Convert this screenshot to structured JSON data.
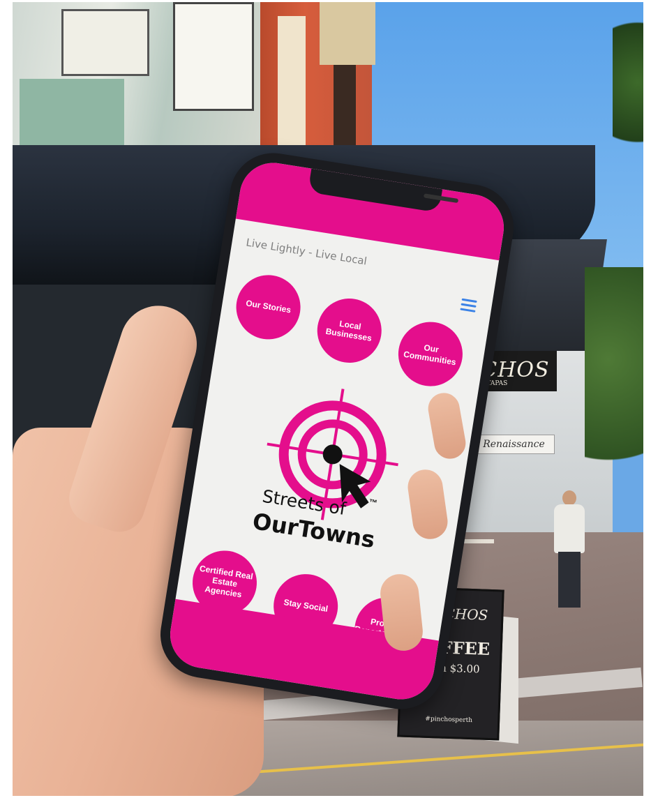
{
  "app": {
    "tagline": "Live Lightly - Live Local",
    "brand_line1": "Streets of",
    "brand_line2": "OurTowns",
    "trademark": "™",
    "accent_color": "#e40e8c",
    "menu_icon": "hamburger-menu-icon"
  },
  "nav_top": [
    {
      "label": "Our Stories"
    },
    {
      "label": "Local Businesses"
    },
    {
      "label": "Our Communities"
    }
  ],
  "nav_bottom": [
    {
      "label": "Certified Real Estate Agencies"
    },
    {
      "label": "Stay Social"
    },
    {
      "label": "Property Reports & Tools"
    }
  ],
  "scene": {
    "shop_sign": "PINCHOS",
    "shop_sign_sub": "BAR DE TAPAS",
    "second_sign": "Renaissance",
    "board_title": "PINCHOS",
    "board_coffee": "COFFEE",
    "board_price": "from $3.00",
    "board_handle": "#pinchosperth"
  }
}
